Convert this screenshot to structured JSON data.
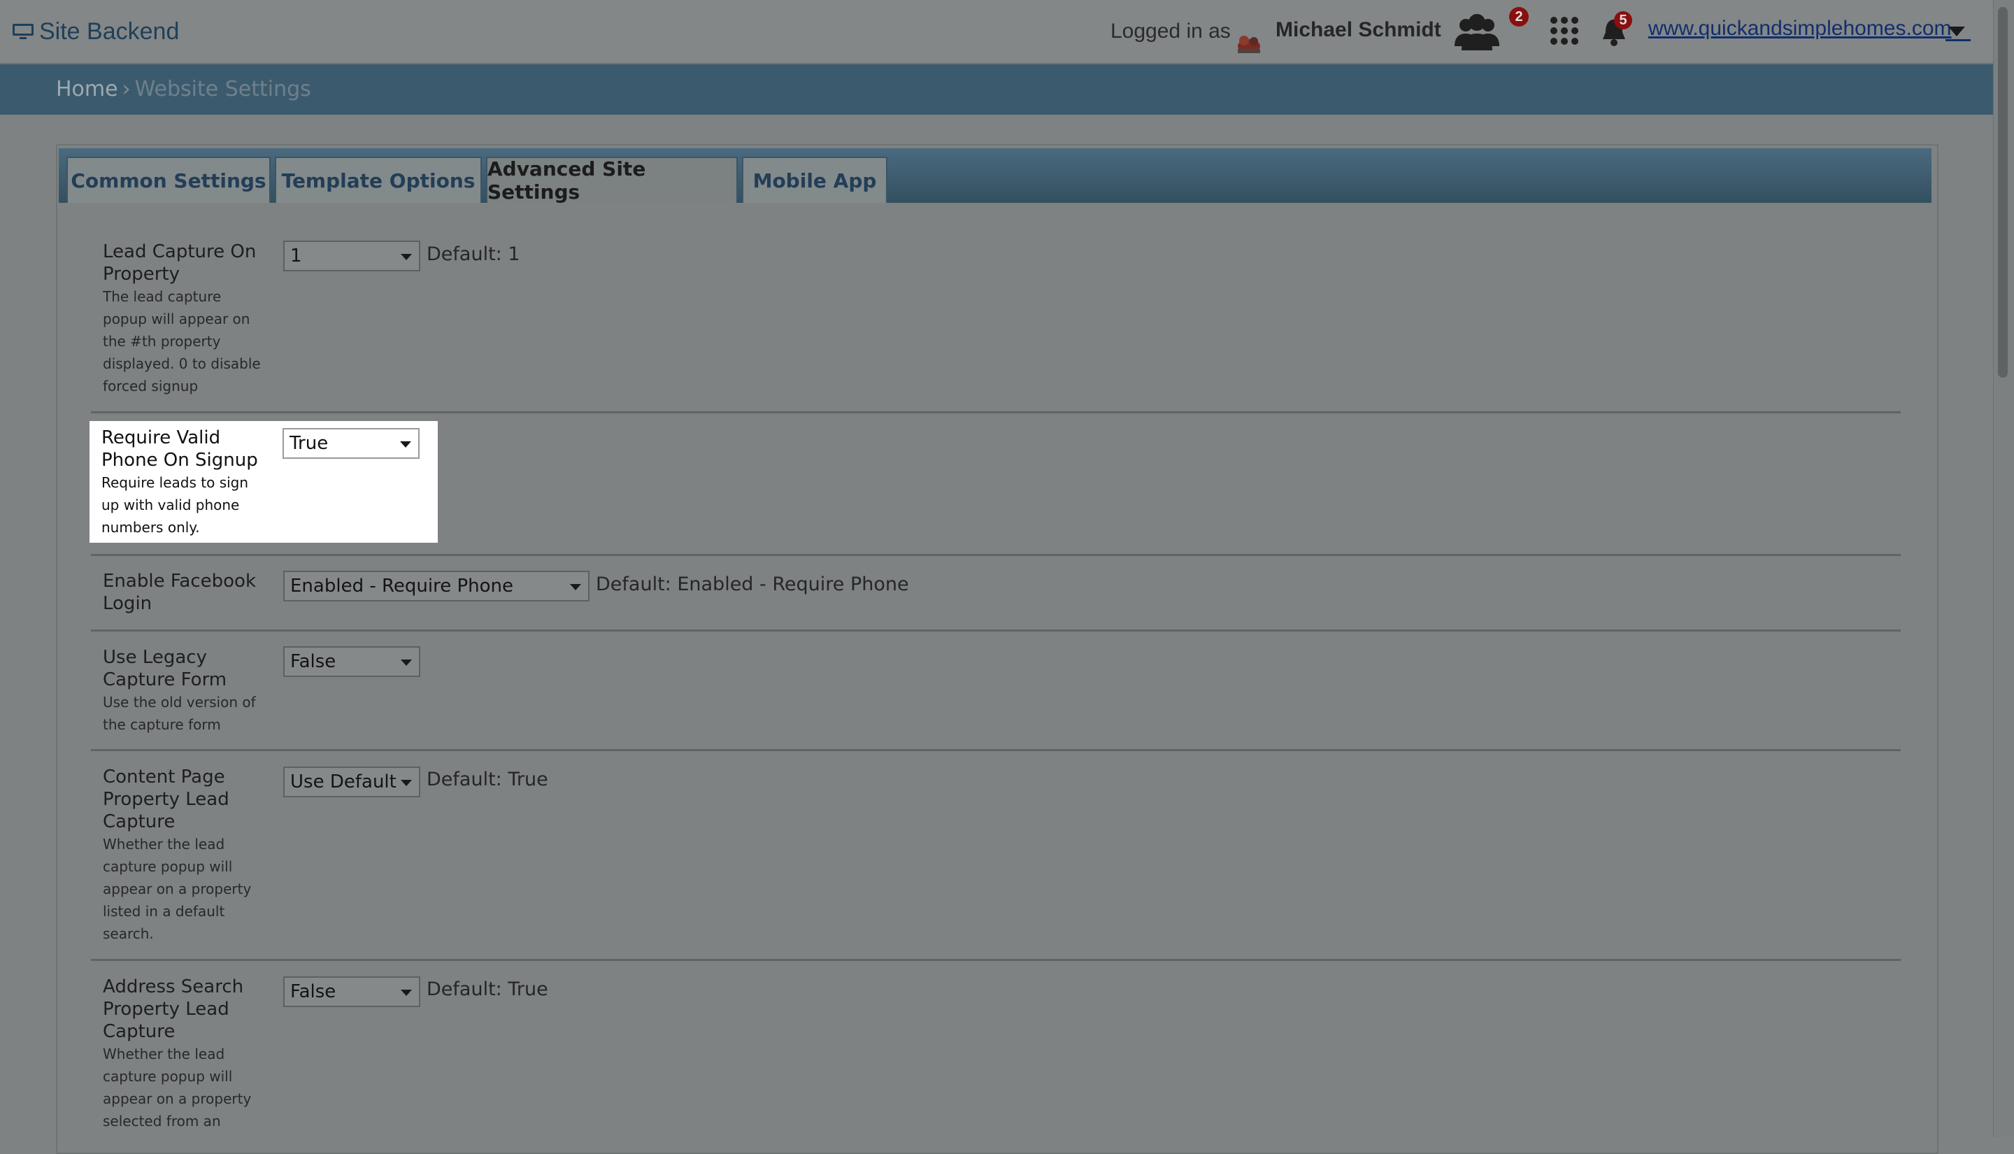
{
  "header": {
    "brand": "Site Backend",
    "logged_in_label": "Logged in as",
    "user_name": "Michael Schmidt",
    "users_badge": "2",
    "notifications_badge": "5",
    "site_url": "www.quickandsimplehomes.com"
  },
  "breadcrumb": {
    "home": "Home",
    "separator": "›",
    "current": "Website Settings"
  },
  "tabs": [
    {
      "label": "Common Settings",
      "active": false
    },
    {
      "label": "Template Options",
      "active": false
    },
    {
      "label": "Advanced Site Settings",
      "active": true
    },
    {
      "label": "Mobile App",
      "active": false
    }
  ],
  "settings": [
    {
      "label": "Lead Capture On Property",
      "description": "The lead capture popup will appear on the #th property displayed. 0 to disable forced signup",
      "value": "1",
      "default": "Default: 1"
    },
    {
      "label": "Require Valid Phone On Signup",
      "description": "Require leads to sign up with valid phone numbers only.",
      "value": "True",
      "default": ""
    },
    {
      "label": "Enable Facebook Login",
      "description": "",
      "value": "Enabled - Require Phone",
      "default": "Default: Enabled - Require Phone"
    },
    {
      "label": "Use Legacy Capture Form",
      "description": "Use the old version of the capture form",
      "value": "False",
      "default": ""
    },
    {
      "label": "Content Page Property Lead Capture",
      "description": "Whether the lead capture popup will appear on a property listed in a default search.",
      "value": "Use Default",
      "default": "Default: True"
    },
    {
      "label": "Address Search Property Lead Capture",
      "description": "Whether the lead capture popup will appear on a property selected from an",
      "value": "False",
      "default": "Default: True"
    }
  ],
  "colors": {
    "overlay_gray": "#7e8282",
    "header_blue": "#3c5a6e",
    "badge_red": "#8a0f0f",
    "link_blue": "#112e6e",
    "highlight_white": "#ffffff"
  }
}
